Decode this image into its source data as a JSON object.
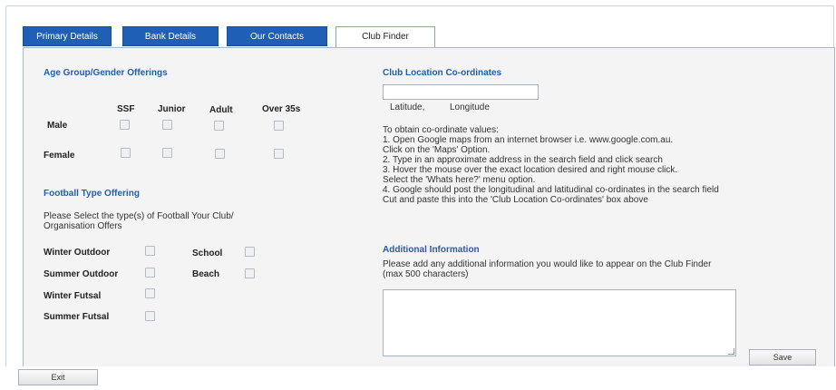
{
  "tabs": [
    "Primary Details",
    "Bank Details",
    "Our Contacts",
    "Club Finder"
  ],
  "age_group": {
    "heading": "Age Group/Gender Offerings",
    "columns": [
      "SSF",
      "Junior",
      "Adult",
      "Over 35s"
    ],
    "rows": [
      "Male",
      "Female"
    ]
  },
  "football_type": {
    "heading": "Football Type Offering",
    "prompt_line1": "Please Select the type(s) of Football Your Club/",
    "prompt_line2": "Organisation Offers",
    "options_left": [
      "Winter Outdoor",
      "Summer Outdoor",
      "Winter Futsal",
      "Summer Futsal"
    ],
    "options_right": [
      "School",
      "Beach"
    ]
  },
  "location": {
    "heading": "Club Location Co-ordinates",
    "latitude_label": "Latitude,",
    "longitude_label": "Longitude",
    "instructions": [
      "To obtain co-ordinate values:",
      "1. Open Google maps from an internet browser i.e. www.google.com.au.",
      "Click on the 'Maps' Option.",
      "2. Type in an approximate address in the search field and click search",
      "3. Hover the mouse over the exact location desired and right mouse click.",
      "Select the 'Whats here?' menu option.",
      "4. Google should post the longitudinal and latitudinal co-ordinates in the search field",
      "Cut and paste this into the 'Club Location Co-ordinates' box above"
    ]
  },
  "additional": {
    "heading": "Additional Information",
    "prompt_line1": "Please add any additional information you would like to appear on the Club Finder",
    "prompt_line2": "(max 500 characters)"
  },
  "buttons": {
    "save": "Save",
    "exit": "Exit"
  }
}
